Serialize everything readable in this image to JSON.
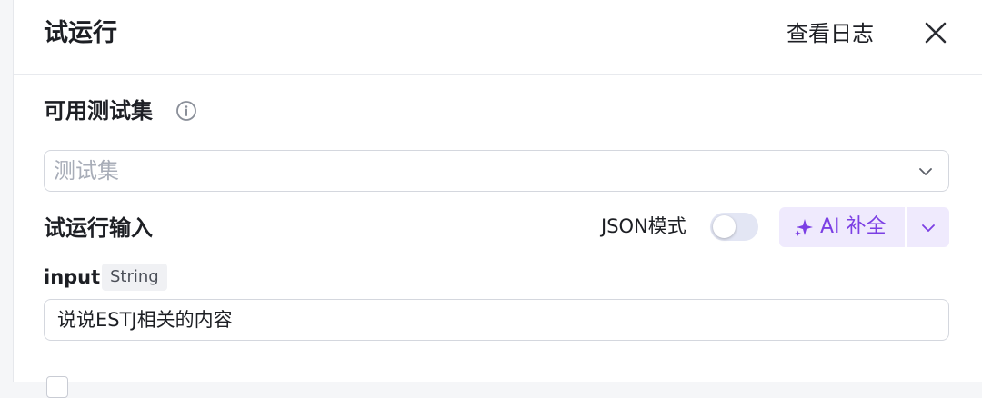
{
  "header": {
    "title": "试运行",
    "view_log_label": "查看日志"
  },
  "test_set": {
    "label": "可用测试集",
    "placeholder": "测试集"
  },
  "trial_input": {
    "label": "试运行输入",
    "json_mode_label": "JSON模式",
    "json_mode_on": false,
    "ai_button_label": "AI 补全"
  },
  "params": [
    {
      "name": "input",
      "type": "String",
      "value": "说说ESTJ相关的内容"
    }
  ],
  "colors": {
    "accent": "#7b3fe4",
    "ai_button_bg": "#efeafd",
    "border": "#d4d7de",
    "placeholder": "#a8adb8"
  },
  "icons": [
    "info-icon",
    "close-icon",
    "chevron-down-icon",
    "sparkle-icon"
  ]
}
